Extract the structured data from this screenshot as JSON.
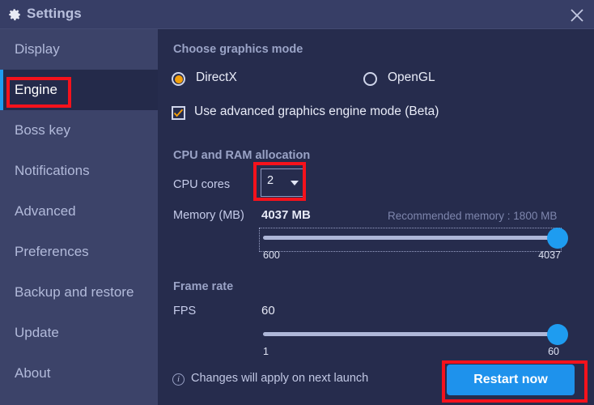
{
  "window": {
    "title": "Settings",
    "gear_icon": "gear-icon",
    "close_icon": "close-icon"
  },
  "sidebar": {
    "items": [
      {
        "label": "Display",
        "selected": false
      },
      {
        "label": "Engine",
        "selected": true
      },
      {
        "label": "Boss key",
        "selected": false
      },
      {
        "label": "Notifications",
        "selected": false
      },
      {
        "label": "Advanced",
        "selected": false
      },
      {
        "label": "Preferences",
        "selected": false
      },
      {
        "label": "Backup and restore",
        "selected": false
      },
      {
        "label": "Update",
        "selected": false
      },
      {
        "label": "About",
        "selected": false
      }
    ]
  },
  "main": {
    "graphics": {
      "section_title": "Choose graphics mode",
      "options": [
        {
          "label": "DirectX",
          "selected": true
        },
        {
          "label": "OpenGL",
          "selected": false
        }
      ],
      "advanced_checkbox": {
        "label": "Use advanced graphics engine mode (Beta)",
        "checked": true
      }
    },
    "cpu_ram": {
      "section_title": "CPU and RAM allocation",
      "cpu_cores_label": "CPU cores",
      "cpu_cores_value": "2",
      "memory_label": "Memory (MB)",
      "memory_value": "4037 MB",
      "recommended_note": "Recommended memory : 1800 MB",
      "memory_slider": {
        "min_label": "600",
        "max_label": "4037",
        "min": 600,
        "max": 4037,
        "value": 4037
      }
    },
    "frame_rate": {
      "section_title": "Frame rate",
      "fps_label": "FPS",
      "fps_value": "60",
      "fps_slider": {
        "min_label": "1",
        "max_label": "60",
        "min": 1,
        "max": 60,
        "value": 60
      }
    },
    "footer": {
      "info_icon": "info-icon",
      "note": "Changes will apply on next launch",
      "restart_label": "Restart now"
    }
  },
  "colors": {
    "accent_blue": "#1e9cf0",
    "accent_orange": "#f3a00b",
    "annotation_red": "#f5121c",
    "titlebar_bg": "#373e66",
    "sidebar_bg": "#3c4369",
    "panel_bg": "#262c4d",
    "selected_item_bg": "#242a4a"
  }
}
